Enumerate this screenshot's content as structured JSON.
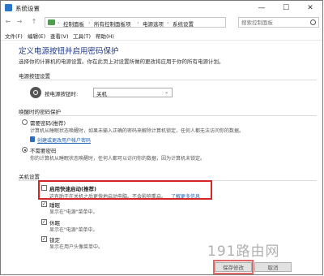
{
  "window": {
    "title": "系统设置",
    "min_glyph": "—",
    "max_glyph": "☐",
    "close_glyph": "✕"
  },
  "nav": {
    "back": "←",
    "forward": "→",
    "up": "↑"
  },
  "breadcrumb": [
    "控制面板",
    "所有控制面板项",
    "电源选项",
    "系统设置"
  ],
  "breadcrumb_sep": "›",
  "search": {
    "placeholder": "搜索控制面板"
  },
  "menu": [
    "文件(F)",
    "编辑(E)",
    "查看(V)",
    "工具(T)",
    "帮助(H)"
  ],
  "page": {
    "heading": "定义电源按钮并启用密码保护",
    "subhead": "选择你的计算机的电源设置。你在此页上对设置所做的更改将应用于你的所有电源计划。"
  },
  "power_button": {
    "section": "电源按钮设置",
    "label": "按电源按钮时:",
    "value": "关机",
    "caret": "⌄"
  },
  "wake_password": {
    "section": "唤醒时的密码保护",
    "option1": {
      "label": "需要密码(推荐)",
      "desc1": "计算机从睡眠状态唤醒时，如果未输入正确的密码来解除计算机锁定，任何人都无法访问你的数据。",
      "link": "创建或更改用户帐户密码"
    },
    "option2": {
      "label": "不需要密码",
      "desc1": "你的计算机从睡眠状态唤醒时，任何人都可以访问你的数据，因为计算机未锁定。"
    }
  },
  "shutdown": {
    "section": "关机设置",
    "fast_startup": {
      "label": "启用快速启动(推荐)",
      "desc": "这有助于在关机之后更快地启动电脑。不会影响重启。",
      "link": "了解更多信息",
      "checked": false
    },
    "items": [
      {
        "label": "睡眠",
        "desc": "显示在\"电源\"菜单中。",
        "checked": true
      },
      {
        "label": "休眠",
        "desc": "显示在\"电源\"菜单中。",
        "checked": true
      },
      {
        "label": "锁定",
        "desc": "显示在用户头像菜单中。",
        "checked": true
      }
    ],
    "check_glyph": "✓"
  },
  "buttons": {
    "save": "保存修改",
    "cancel": "取消"
  },
  "watermark": "191路由网",
  "colors": {
    "heading": "#1e3a8a",
    "link": "#1a5fb4",
    "highlight": "#d42626"
  }
}
